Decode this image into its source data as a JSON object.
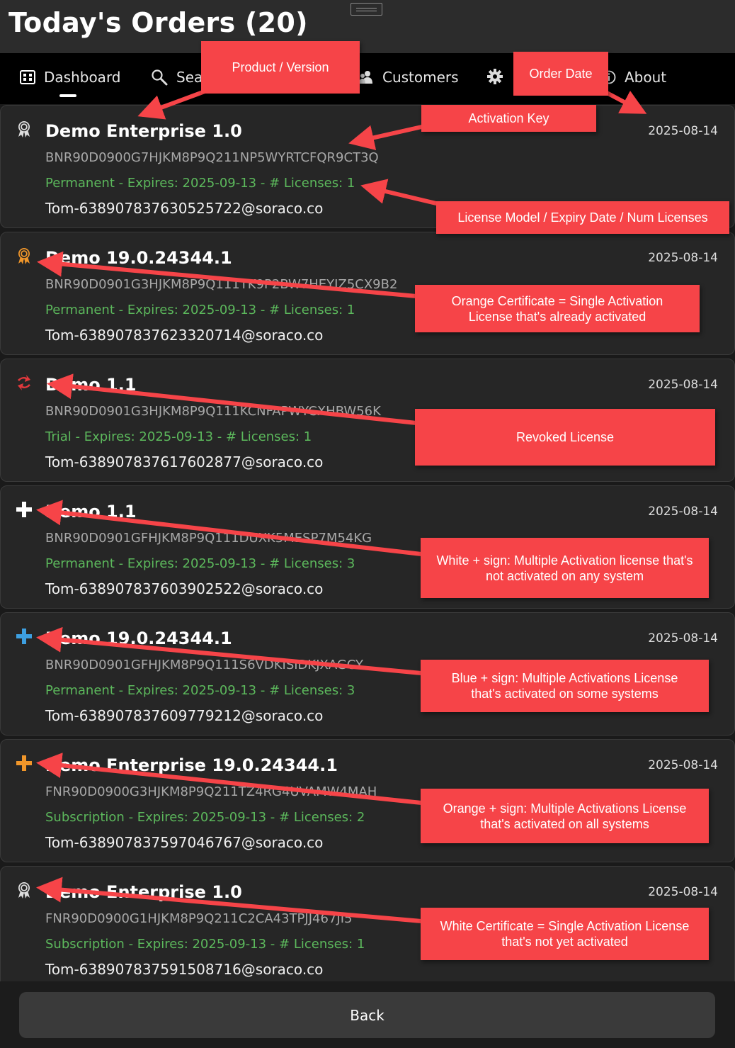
{
  "header": {
    "title": "Today's Orders (20)"
  },
  "nav": {
    "dashboard": "Dashboard",
    "search": "Sea",
    "customers": "Customers",
    "about": "About"
  },
  "orders": [
    {
      "icon": "white-certificate-icon",
      "product": "Demo Enterprise 1.0",
      "date": "2025-08-14",
      "key": "BNR90D0900G7HJKM8P9Q211NP5WYRTCFQR9CT3Q",
      "license": "Permanent - Expires: 2025-09-13 - # Licenses: 1",
      "email": "Tom-638907837630525722@soraco.co"
    },
    {
      "icon": "orange-certificate-icon",
      "product": "Demo 19.0.24344.1",
      "date": "2025-08-14",
      "key": "BNR90D0901G3HJKM8P9Q111TK9P2BW7HEYIZ5CX9B2",
      "license": "Permanent - Expires: 2025-09-13 - # Licenses: 1",
      "email": "Tom-638907837623320714@soraco.co"
    },
    {
      "icon": "revoked-icon",
      "product": "Demo 1.1",
      "date": "2025-08-14",
      "key": "BNR90D0901G3HJKM8P9Q111KCNFAPWYCXHBW56K",
      "license": "Trial - Expires: 2025-09-13 - # Licenses: 1",
      "email": "Tom-638907837617602877@soraco.co"
    },
    {
      "icon": "white-plus-icon",
      "product": "Demo 1.1",
      "date": "2025-08-14",
      "key": "BNR90D0901GFHJKM8P9Q111DUXK5MESP7M54KG",
      "license": "Permanent - Expires: 2025-09-13 - # Licenses: 3",
      "email": "Tom-638907837603902522@soraco.co"
    },
    {
      "icon": "blue-plus-icon",
      "product": "Demo 19.0.24344.1",
      "date": "2025-08-14",
      "key": "BNR90D0901GFHJKM8P9Q111S6VDKISIDKJXAGCY",
      "license": "Permanent - Expires: 2025-09-13 - # Licenses: 3",
      "email": "Tom-638907837609779212@soraco.co"
    },
    {
      "icon": "orange-plus-icon",
      "product": "Demo Enterprise 19.0.24344.1",
      "date": "2025-08-14",
      "key": "FNR90D0900G3HJKM8P9Q211TZ4RG4UVAMW4MAH",
      "license": "Subscription - Expires: 2025-09-13 - # Licenses: 2",
      "email": "Tom-638907837597046767@soraco.co"
    },
    {
      "icon": "white-certificate-icon",
      "product": "Demo Enterprise 1.0",
      "date": "2025-08-14",
      "key": "FNR90D0900G1HJKM8P9Q211C2CA43TPJJ467JI5",
      "license": "Subscription - Expires: 2025-09-13 - # Licenses: 1",
      "email": "Tom-638907837591508716@soraco.co"
    }
  ],
  "footer": {
    "back_label": "Back"
  },
  "callouts": {
    "product_version": "Product / Version",
    "order_date": "Order Date",
    "activation_key": "Activation Key",
    "license_model": "License Model / Expiry Date / Num Licenses",
    "orange_cert": "Orange Certificate = Single Activation License that's already activated",
    "revoked": "Revoked License",
    "white_plus": "White + sign: Multiple Activation license that's not activated on any system",
    "blue_plus": "Blue + sign: Multiple Activations License that's activated on some systems",
    "orange_plus": "Orange + sign: Multiple Activations License that's activated on all systems",
    "white_cert": "White Certificate = Single Activation License that's not yet activated"
  },
  "colors": {
    "callout": "#f64448",
    "license_text": "#5cb85c",
    "blue_icon": "#3d9fe0",
    "orange_icon": "#f0962a",
    "revoked_icon": "#e0383c"
  }
}
